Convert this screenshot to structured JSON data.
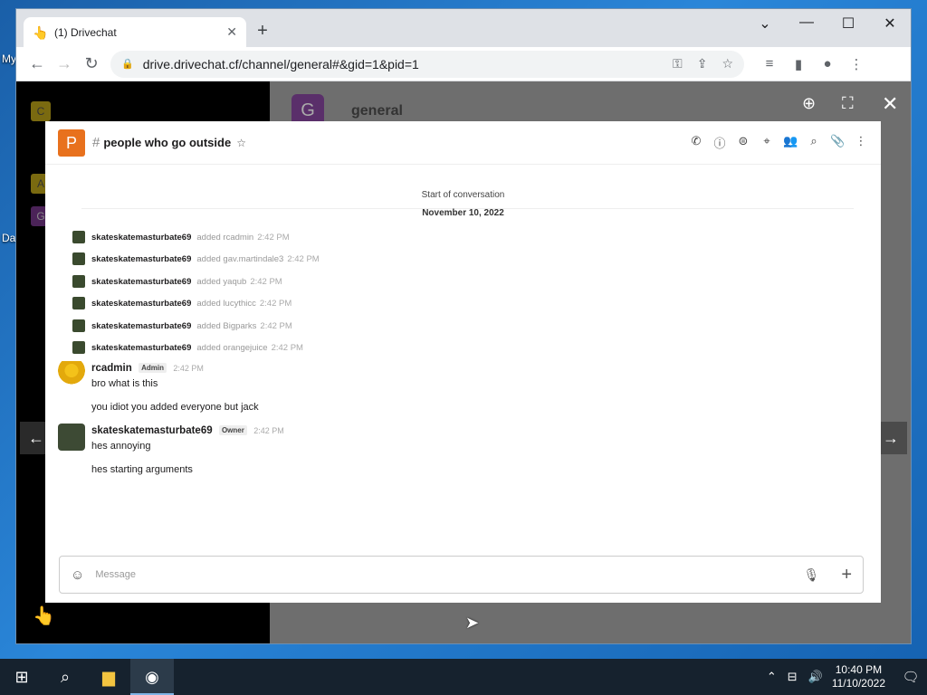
{
  "desktop": {
    "icon_labels": [
      "My",
      "Da"
    ]
  },
  "browser": {
    "tab_title": "(1) Drivechat",
    "url": "drive.drivechat.cf/channel/general#&gid=1&pid=1",
    "window_controls": [
      "chevron-down",
      "minimize",
      "maximize",
      "close"
    ]
  },
  "background_app": {
    "channel_letter": "G",
    "channel_title": "general",
    "left_letters": [
      "C",
      "A",
      "G"
    ]
  },
  "modal": {
    "avatar_letter": "P",
    "channel_name": "people who go outside",
    "start_label": "Start of conversation",
    "date_label": "November 10, 2022",
    "system_events": [
      {
        "user": "skateskatemasturbate69",
        "action": "added rcadmin",
        "time": "2:42 PM"
      },
      {
        "user": "skateskatemasturbate69",
        "action": "added gav.martindale3",
        "time": "2:42 PM"
      },
      {
        "user": "skateskatemasturbate69",
        "action": "added yaqub",
        "time": "2:42 PM"
      },
      {
        "user": "skateskatemasturbate69",
        "action": "added lucythicc",
        "time": "2:42 PM"
      },
      {
        "user": "skateskatemasturbate69",
        "action": "added Bigparks",
        "time": "2:42 PM"
      },
      {
        "user": "skateskatemasturbate69",
        "action": "added orangejuice",
        "time": "2:42 PM"
      }
    ],
    "messages": [
      {
        "user": "rcadmin",
        "badge": "Admin",
        "time": "2:42 PM",
        "lines": [
          "bro what is this",
          "you idiot you added everyone but jack"
        ]
      },
      {
        "user": "skateskatemasturbate69",
        "badge": "Owner",
        "time": "2:42 PM",
        "lines": [
          "hes annoying",
          "hes starting arguments"
        ]
      }
    ],
    "composer_placeholder": "Message"
  },
  "taskbar": {
    "time": "10:40 PM",
    "date": "11/10/2022"
  }
}
